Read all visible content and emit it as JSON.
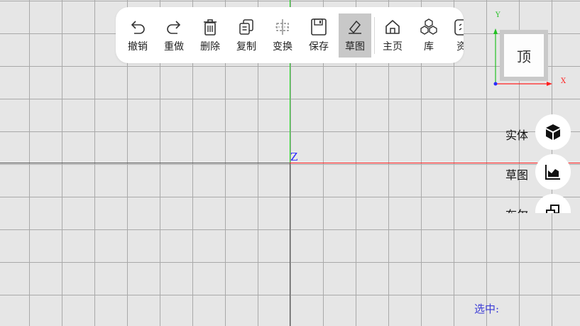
{
  "toolbar": {
    "buttons": [
      {
        "label": "撤销",
        "icon": "undo-icon"
      },
      {
        "label": "重做",
        "icon": "redo-icon"
      },
      {
        "label": "删除",
        "icon": "trash-icon"
      },
      {
        "label": "复制",
        "icon": "copy-icon"
      },
      {
        "label": "变换",
        "icon": "transform-icon"
      },
      {
        "label": "保存",
        "icon": "save-icon"
      },
      {
        "label": "草图",
        "icon": "sketch-pen-icon",
        "active": true
      },
      {
        "label": "主页",
        "icon": "home-icon"
      },
      {
        "label": "库",
        "icon": "library-cubes-icon"
      },
      {
        "label": "资",
        "icon": "resource-icon"
      }
    ]
  },
  "viewcube": {
    "face_label": "顶",
    "axis_y": "Y",
    "axis_x": "X"
  },
  "viewport": {
    "origin_label": "Z",
    "colors": {
      "x_axis": "#ff2020",
      "y_axis": "#22d622",
      "z_label": "#2a2aff",
      "grid": "#a9a9a9",
      "background": "#e6e6e6"
    }
  },
  "side_panel": {
    "items": [
      {
        "label": "实体",
        "icon": "solid-cube-icon"
      },
      {
        "label": "草图",
        "icon": "sketch-chart-icon"
      },
      {
        "label": "布尔",
        "icon": "boolean-icon"
      }
    ]
  },
  "status": {
    "selection_label": "选中:"
  }
}
